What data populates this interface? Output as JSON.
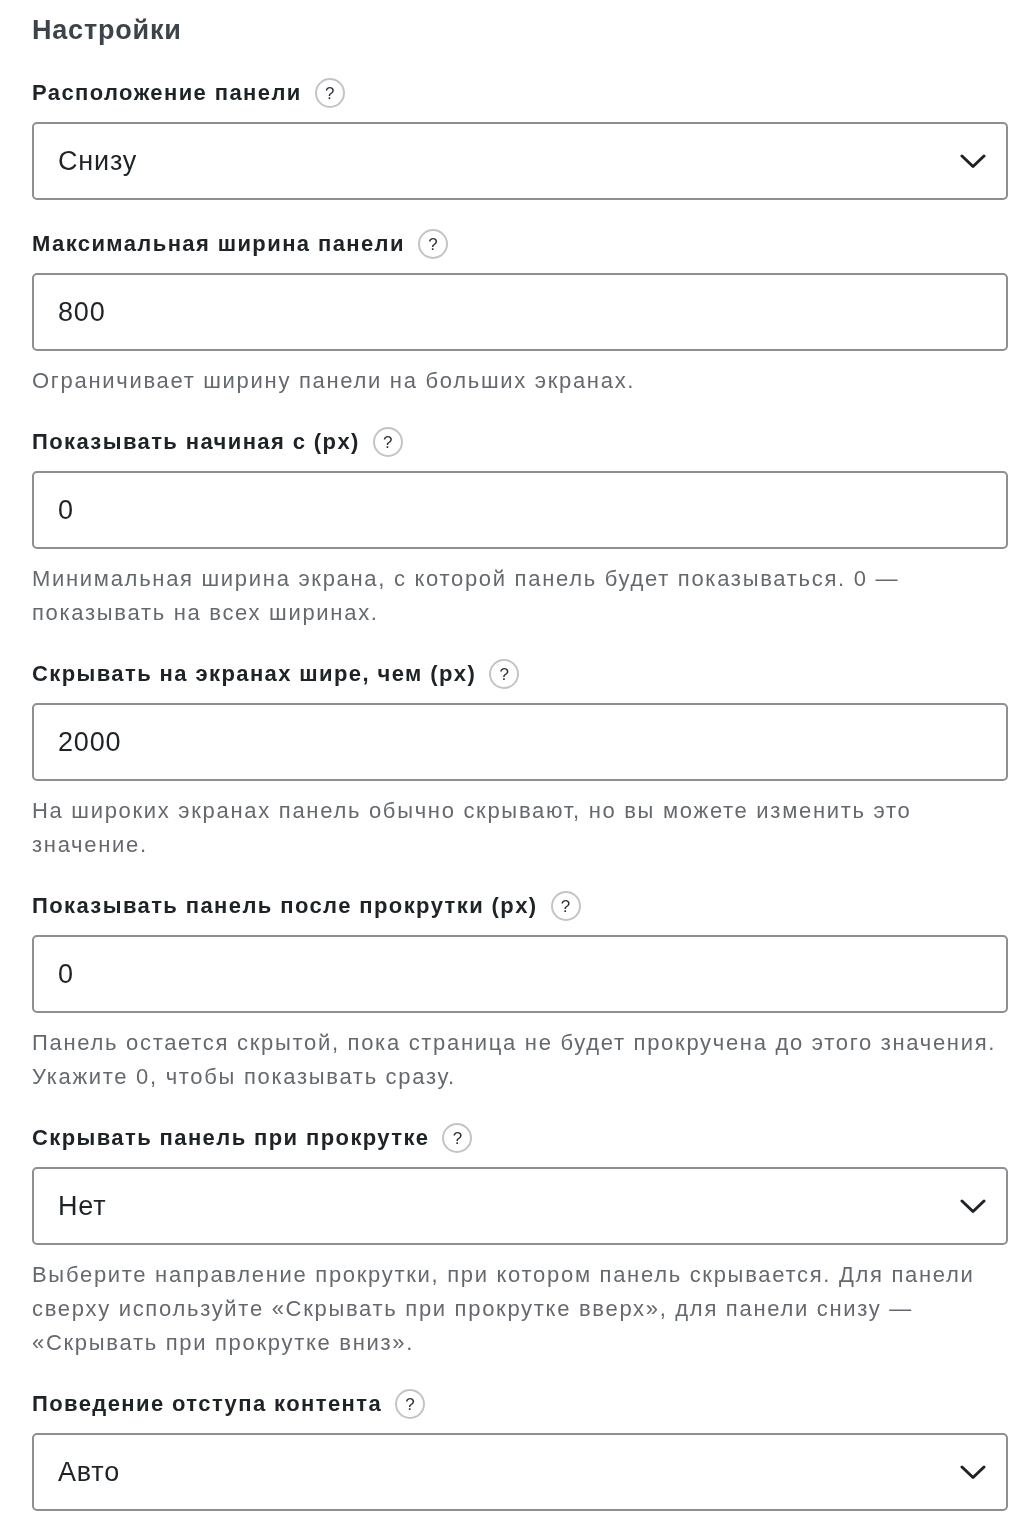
{
  "section": {
    "title": "Настройки"
  },
  "settings": [
    {
      "kind": "select",
      "label": "Расположение панели",
      "help_icon": "?",
      "value": "Снизу"
    },
    {
      "kind": "input",
      "label": "Максимальная ширина панели",
      "help_icon": "?",
      "value": "800",
      "description": "Ограничивает ширину панели на больших экранах."
    },
    {
      "kind": "input",
      "label": "Показывать начиная с (px)",
      "help_icon": "?",
      "value": "0",
      "description": "Минимальная ширина экрана, с которой панель будет показываться. 0 — показывать на всех ширинах."
    },
    {
      "kind": "input",
      "label": "Скрывать на экранах шире, чем (px)",
      "help_icon": "?",
      "value": "2000",
      "description": "На широких экранах панель обычно скрывают, но вы можете изменить это значение."
    },
    {
      "kind": "input",
      "label": "Показывать панель после прокрутки (px)",
      "help_icon": "?",
      "value": "0",
      "description": "Панель остается скрытой, пока страница не будет прокручена до этого значения. Укажите 0, чтобы показывать сразу."
    },
    {
      "kind": "select",
      "label": "Скрывать панель при прокрутке",
      "help_icon": "?",
      "value": "Нет",
      "description": "Выберите направление прокрутки, при котором панель скрывается. Для панели сверху используйте «Скрывать при прокрутке вверх», для панели снизу — «Скрывать при прокрутке вниз»."
    },
    {
      "kind": "select",
      "label": "Поведение отступа контента",
      "help_icon": "?",
      "value": "Авто"
    }
  ]
}
